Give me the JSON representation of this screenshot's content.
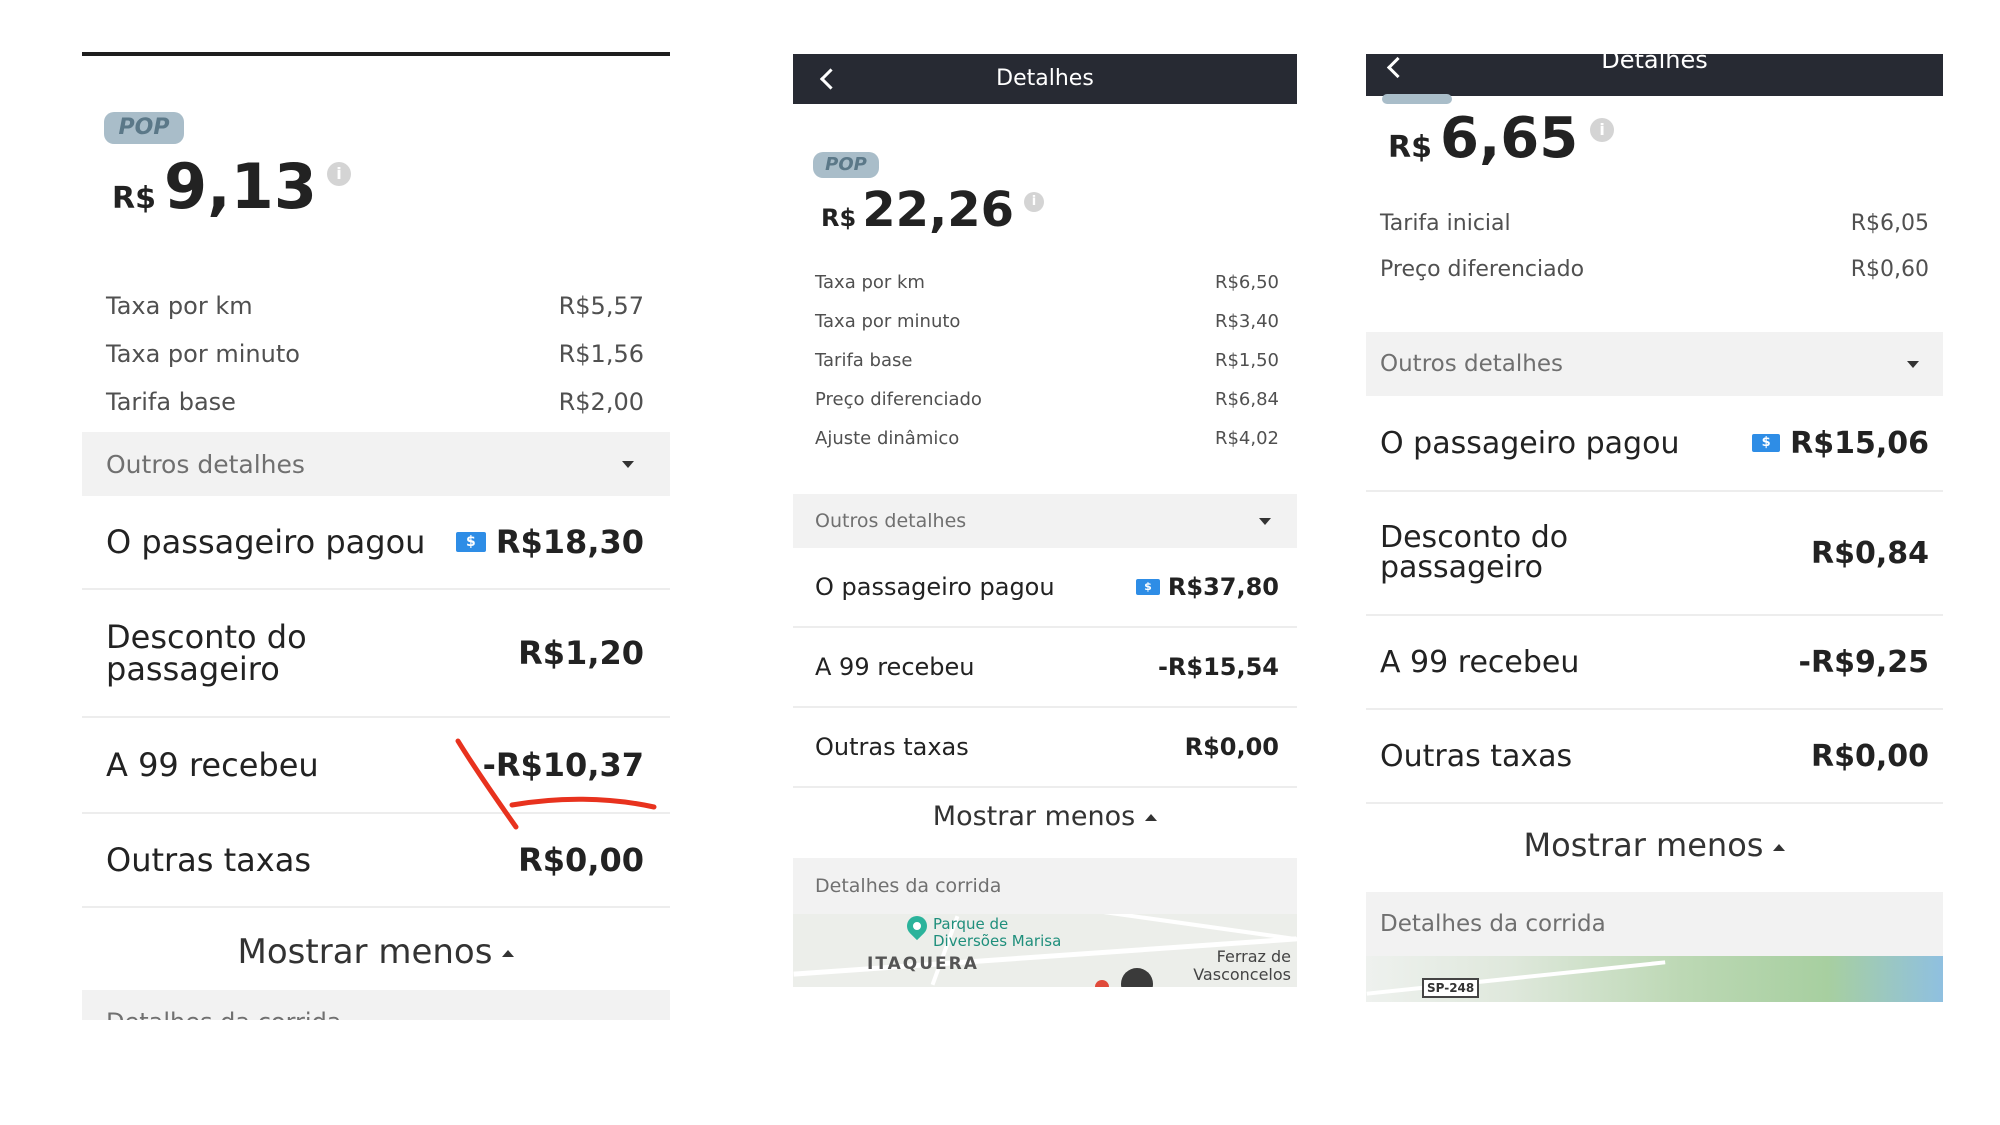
{
  "panel1": {
    "badge": "POP",
    "price_currency": "R$",
    "price_value": "9,13",
    "info_icon": "i",
    "fees": [
      {
        "label": "Taxa por km",
        "value": "R$5,57"
      },
      {
        "label": "Taxa por minuto",
        "value": "R$1,56"
      },
      {
        "label": "Tarifa base",
        "value": "R$2,00"
      }
    ],
    "other_details_label": "Outros detalhes",
    "rows": {
      "paid": {
        "label": "O passageiro pagou",
        "value": "R$18,30"
      },
      "discount": {
        "label_line1": "Desconto do",
        "label_line2": "passageiro",
        "value": "R$1,20"
      },
      "received": {
        "label": "A 99 recebeu",
        "value": "-R$10,37"
      },
      "other_fees": {
        "label": "Outras taxas",
        "value": "R$0,00"
      }
    },
    "show_less": "Mostrar menos",
    "ride_details": "Detalhes da corrida"
  },
  "panel2": {
    "header_title": "Detalhes",
    "badge": "POP",
    "price_currency": "R$",
    "price_value": "22,26",
    "info_icon": "i",
    "fees": [
      {
        "label": "Taxa por km",
        "value": "R$6,50"
      },
      {
        "label": "Taxa por minuto",
        "value": "R$3,40"
      },
      {
        "label": "Tarifa base",
        "value": "R$1,50"
      },
      {
        "label": "Preço diferenciado",
        "value": "R$6,84"
      },
      {
        "label": "Ajuste dinâmico",
        "value": "R$4,02"
      }
    ],
    "other_details_label": "Outros detalhes",
    "rows": {
      "paid": {
        "label": "O passageiro pagou",
        "value": "R$37,80"
      },
      "received": {
        "label": "A 99 recebeu",
        "value": "-R$15,54"
      },
      "other_fees": {
        "label": "Outras taxas",
        "value": "R$0,00"
      }
    },
    "show_less": "Mostrar menos",
    "ride_details": "Detalhes da corrida",
    "map": {
      "poi_line1": "Parque de",
      "poi_line2": "Diversões Marisa",
      "district": "ITAQUERA",
      "city_line1": "Ferraz de",
      "city_line2": "Vasconcelos"
    }
  },
  "panel3": {
    "header_title": "Detalhes",
    "price_currency": "R$",
    "price_value": "6,65",
    "info_icon": "i",
    "fees": [
      {
        "label": "Tarifa inicial",
        "value": "R$6,05"
      },
      {
        "label": "Preço diferenciado",
        "value": "R$0,60"
      }
    ],
    "other_details_label": "Outros detalhes",
    "rows": {
      "paid": {
        "label": "O passageiro pagou",
        "value": "R$15,06"
      },
      "discount": {
        "label_line1": "Desconto do",
        "label_line2": "passageiro",
        "value": "R$0,84"
      },
      "received": {
        "label": "A 99 recebeu",
        "value": "-R$9,25"
      },
      "other_fees": {
        "label": "Outras taxas",
        "value": "R$0,00"
      }
    },
    "show_less": "Mostrar menos",
    "ride_details": "Detalhes da corrida",
    "map": {
      "road_shield": "SP-248"
    }
  },
  "colors": {
    "header_bg": "#272a33",
    "badge_bg": "#a9bdc9",
    "cash_icon": "#2e8de6",
    "annotation": "#e8321e",
    "section_bg": "#f2f2f2"
  },
  "icons": [
    "back-arrow-icon",
    "info-icon",
    "cash-icon",
    "chevron-down-icon",
    "chevron-up-icon",
    "map-pin-icon"
  ]
}
